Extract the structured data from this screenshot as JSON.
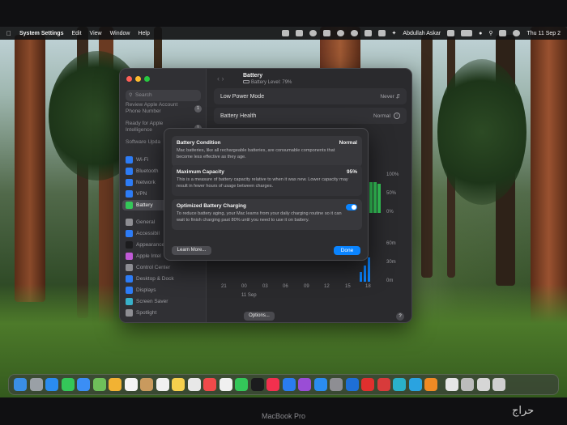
{
  "menubar": {
    "app_name": "System Settings",
    "menus": [
      "Edit",
      "View",
      "Window",
      "Help"
    ],
    "user": "Abdullah Askar",
    "clock": "Thu 11 Sep 2"
  },
  "sidebar": {
    "search_placeholder": "Search",
    "apple_account_line": "Review Apple Account",
    "phone_line": "Phone Number",
    "apple_account_badge": "1",
    "intelligence_line1": "Ready for Apple",
    "intelligence_line2": "Intelligence",
    "intelligence_badge": "1",
    "software_update": "Software Upda",
    "software_update_badge": "1",
    "items": [
      {
        "label": "Wi-Fi",
        "icon": "wifi-icon",
        "color": "#2d7cf6"
      },
      {
        "label": "Bluetooth",
        "icon": "bluetooth-icon",
        "color": "#2d7cf6"
      },
      {
        "label": "Network",
        "icon": "network-icon",
        "color": "#2d7cf6"
      },
      {
        "label": "VPN",
        "icon": "vpn-icon",
        "color": "#2d7cf6"
      },
      {
        "label": "Battery",
        "icon": "battery-icon",
        "color": "#34c759"
      },
      {
        "label": "General",
        "icon": "gear-icon",
        "color": "#8e8e93"
      },
      {
        "label": "Accessibil",
        "icon": "accessibility-icon",
        "color": "#2d7cf6"
      },
      {
        "label": "Appearance",
        "icon": "appearance-icon",
        "color": "#1c1c1e"
      },
      {
        "label": "Apple Intel",
        "icon": "apple-intelligence-icon",
        "color": "#c05ad6"
      },
      {
        "label": "Control Center",
        "icon": "control-center-icon",
        "color": "#8e8e93"
      },
      {
        "label": "Desktop & Dock",
        "icon": "desktop-dock-icon",
        "color": "#2d7cf6"
      },
      {
        "label": "Displays",
        "icon": "displays-icon",
        "color": "#2d7cf6"
      },
      {
        "label": "Screen Saver",
        "icon": "screen-saver-icon",
        "color": "#38b0c9"
      },
      {
        "label": "Spotlight",
        "icon": "spotlight-icon",
        "color": "#8e8e93"
      }
    ],
    "selected": "Battery"
  },
  "header": {
    "title": "Battery",
    "subtitle": "Battery Level: 79%"
  },
  "settings": {
    "low_power_label": "Low Power Mode",
    "low_power_value": "Never",
    "health_label": "Battery Health",
    "health_value": "Normal"
  },
  "chart": {
    "level_ticks": [
      "100%",
      "50%",
      "0%"
    ],
    "usage_ticks": [
      "60m",
      "30m",
      "0m"
    ],
    "hours": [
      "21",
      "00",
      "03",
      "06",
      "09",
      "12",
      "15",
      "18"
    ],
    "date": "11 Sep"
  },
  "footer": {
    "options_label": "Options...",
    "help_label": "?"
  },
  "sheet": {
    "condition_title": "Battery Condition",
    "condition_value": "Normal",
    "condition_desc": "Mac batteries, like all rechargeable batteries, are consumable components that become less effective as they age.",
    "capacity_title": "Maximum Capacity",
    "capacity_value": "95%",
    "capacity_desc": "This is a measure of battery capacity relative to when it was new. Lower capacity may result in fewer hours of usage between charges.",
    "optimized_title": "Optimized Battery Charging",
    "optimized_enabled": true,
    "optimized_desc": "To reduce battery aging, your Mac learns from your daily charging routine so it can wait to finish charging past 80% until you need to use it on battery.",
    "learn_more": "Learn More...",
    "done": "Done"
  },
  "dock": {
    "apps": [
      {
        "name": "finder-icon",
        "color": "#3a8ee6"
      },
      {
        "name": "launchpad-icon",
        "color": "#9aa0a6"
      },
      {
        "name": "safari-icon",
        "color": "#2a8cf0"
      },
      {
        "name": "messages-icon",
        "color": "#34c759"
      },
      {
        "name": "mail-icon",
        "color": "#3b8ef5"
      },
      {
        "name": "maps-icon",
        "color": "#6fbf5a"
      },
      {
        "name": "photos-icon",
        "color": "#f2b233"
      },
      {
        "name": "calendar-icon",
        "color": "#f4f4f4"
      },
      {
        "name": "contacts-icon",
        "color": "#c99a5e"
      },
      {
        "name": "reminders-icon",
        "color": "#f0f0f0"
      },
      {
        "name": "notes-icon",
        "color": "#f6d04d"
      },
      {
        "name": "chrome-icon",
        "color": "#e8e8e8"
      },
      {
        "name": "news-icon",
        "color": "#f04a4a"
      },
      {
        "name": "freeform-icon",
        "color": "#f0f0f0"
      },
      {
        "name": "facetime-icon",
        "color": "#34c759"
      },
      {
        "name": "appletv-icon",
        "color": "#1c1c1e"
      },
      {
        "name": "music-icon",
        "color": "#f2304e"
      },
      {
        "name": "keynote-icon",
        "color": "#2a7cf0"
      },
      {
        "name": "podcasts-icon",
        "color": "#9a4dd6"
      },
      {
        "name": "appstore-icon",
        "color": "#2a8cf0"
      },
      {
        "name": "system-settings-icon",
        "color": "#8e8e93"
      },
      {
        "name": "outlook-icon",
        "color": "#1e6fd6"
      },
      {
        "name": "acrobat-icon",
        "color": "#e0302e"
      },
      {
        "name": "pdf-icon",
        "color": "#d83b3b"
      },
      {
        "name": "edge-icon",
        "color": "#2ab0c9"
      },
      {
        "name": "telegram-icon",
        "color": "#2aa3e0"
      },
      {
        "name": "vlc-icon",
        "color": "#f08a24"
      },
      {
        "name": "document-icon",
        "color": "#e6e6e6"
      },
      {
        "name": "folder-icon",
        "color": "#bcbcbc"
      },
      {
        "name": "window-icon",
        "color": "#d6d6d6"
      },
      {
        "name": "trash-icon",
        "color": "#cfcfcf"
      }
    ]
  },
  "device_label": "MacBook Pro",
  "watermark": "حراج"
}
